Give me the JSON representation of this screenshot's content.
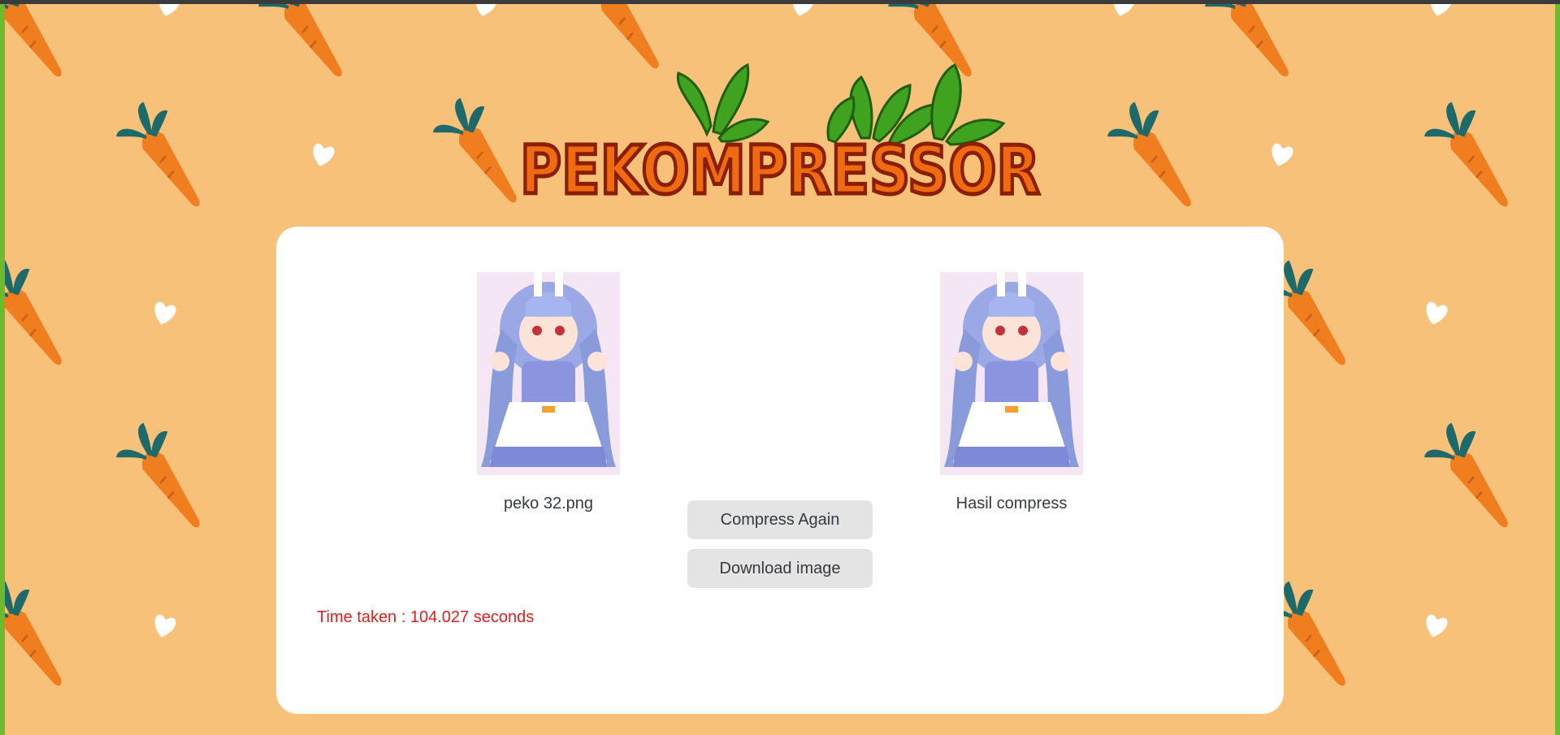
{
  "app": {
    "logo_text": "PEKOMPRESSOR",
    "colors": {
      "background": "#f8c17a",
      "carrot": "#f07d1e",
      "carrot_leaf": "#1e6a6a",
      "card": "#ffffff",
      "button": "#e4e4e4",
      "time_text": "#e0211f"
    }
  },
  "original": {
    "filename": "peko 32.png",
    "image_icon": "anime-character-image"
  },
  "result": {
    "label": "Hasil compress",
    "image_icon": "anime-character-image"
  },
  "actions": {
    "compress_again": "Compress Again",
    "download": "Download image"
  },
  "stats": {
    "time_text": "Time taken : 104.027 seconds"
  }
}
